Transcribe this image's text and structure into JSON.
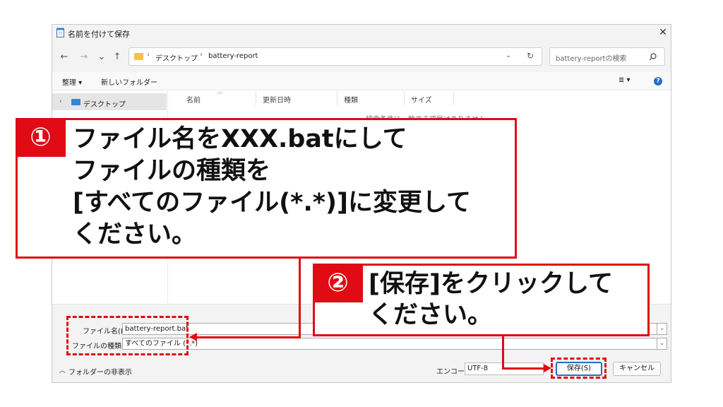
{
  "window": {
    "title": "名前を付けて保存",
    "close": "✕"
  },
  "nav": {
    "back": "←",
    "forward": "→",
    "down": "⌄",
    "up": "↑",
    "breadcrumb": [
      "デスクトップ",
      "battery-report"
    ],
    "refresh": "↻",
    "dropdown": "⌄",
    "search_placeholder": "battery-reportの検索"
  },
  "toolbar": {
    "organize": "整理 ▾",
    "new_folder": "新しいフォルダー",
    "view": "≣ ▾",
    "help": "?"
  },
  "sidebar": {
    "items": [
      {
        "label": "デスクトップ"
      }
    ]
  },
  "columns": {
    "name": "名前",
    "modified": "更新日時",
    "type": "種類",
    "size": "サイズ"
  },
  "empty_message": "検索条件に一致する項目はありません。",
  "form": {
    "filename_label": "ファイル名(N):",
    "filename_value": "battery-report.bat",
    "filetype_label": "ファイルの種類(T):",
    "filetype_value": "すべてのファイル (*.*)",
    "hide_folders": "フォルダーの非表示",
    "encoding_label": "エンコード:",
    "encoding_value": "UTF-8",
    "save_button": "保存(S)",
    "cancel_button": "キャンセル"
  },
  "annotations": [
    {
      "number": "①",
      "lines": [
        "ファイル名をXXX.batにして",
        "ファイルの種類を",
        "[すべてのファイル(*.*)]に変更して",
        "ください。"
      ]
    },
    {
      "number": "②",
      "lines": [
        "[保存]をクリックして",
        "ください。"
      ]
    }
  ],
  "colors": {
    "accent_red": "#e00b14",
    "help_blue": "#1f6fc9"
  }
}
